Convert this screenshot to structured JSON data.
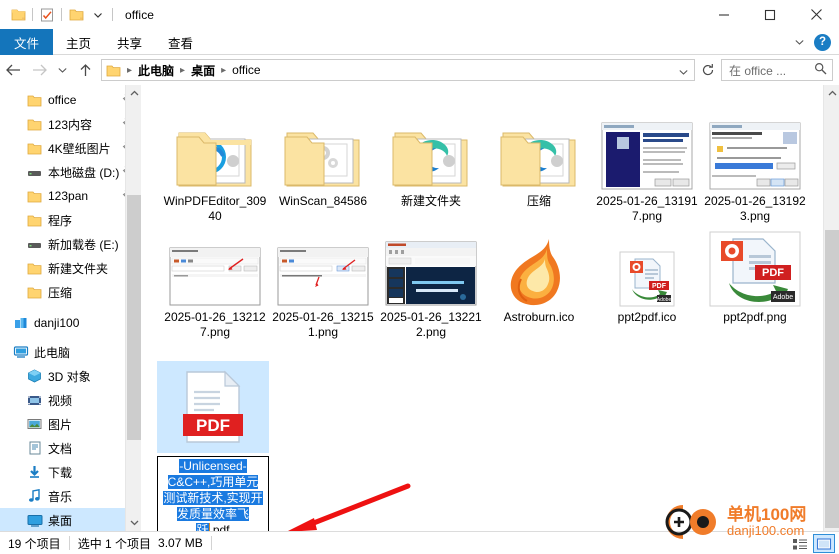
{
  "window": {
    "title": "office",
    "quick_access": [
      {
        "name": "folder-icon",
        "label": "文件夹"
      },
      {
        "name": "properties-icon",
        "label": "属性"
      },
      {
        "name": "new-folder-icon",
        "label": "新建文件夹"
      },
      {
        "name": "chevron-down-icon",
        "label": "自定义快速访问工具栏"
      }
    ],
    "controls": {
      "minimize": "最小化",
      "maximize": "最大化",
      "close": "关闭"
    }
  },
  "ribbon": {
    "tabs": [
      {
        "label": "文件",
        "active": true
      },
      {
        "label": "主页",
        "active": false
      },
      {
        "label": "共享",
        "active": false
      },
      {
        "label": "查看",
        "active": false
      }
    ],
    "collapse_label": "展开功能区",
    "help_label": "?"
  },
  "address": {
    "back": "后退",
    "forward": "前进",
    "recent": "最近浏览的位置",
    "up": "上一级",
    "crumbs": [
      "此电脑",
      "桌面",
      "office"
    ],
    "dropdown": "历史记录",
    "refresh": "刷新",
    "search_placeholder": "在 office ..."
  },
  "sidebar": {
    "items": [
      {
        "label": "office",
        "icon": "folder-icon",
        "pinned": true,
        "indent": 1
      },
      {
        "label": "123内容",
        "icon": "folder-icon",
        "pinned": true,
        "indent": 1
      },
      {
        "label": "4K壁纸图片",
        "icon": "folder-icon",
        "pinned": true,
        "indent": 1
      },
      {
        "label": "本地磁盘 (D:)",
        "icon": "drive-icon",
        "pinned": true,
        "indent": 1
      },
      {
        "label": "123pan",
        "icon": "folder-icon",
        "pinned": true,
        "indent": 1
      },
      {
        "label": "程序",
        "icon": "folder-icon",
        "pinned": false,
        "indent": 1
      },
      {
        "label": "新加载卷 (E:)",
        "icon": "drive-icon",
        "pinned": false,
        "indent": 1
      },
      {
        "label": "新建文件夹",
        "icon": "folder-icon",
        "pinned": false,
        "indent": 1
      },
      {
        "label": "压缩",
        "icon": "folder-icon",
        "pinned": false,
        "indent": 1
      },
      {
        "label": "danji100",
        "icon": "onedrive-icon",
        "pinned": false,
        "indent": 0
      },
      {
        "label": "此电脑",
        "icon": "this-pc-icon",
        "pinned": false,
        "indent": 0
      },
      {
        "label": "3D 对象",
        "icon": "3d-objects-icon",
        "pinned": false,
        "indent": 1
      },
      {
        "label": "视频",
        "icon": "videos-icon",
        "pinned": false,
        "indent": 1
      },
      {
        "label": "图片",
        "icon": "pictures-icon",
        "pinned": false,
        "indent": 1
      },
      {
        "label": "文档",
        "icon": "documents-icon",
        "pinned": false,
        "indent": 1
      },
      {
        "label": "下载",
        "icon": "downloads-icon",
        "pinned": false,
        "indent": 1
      },
      {
        "label": "音乐",
        "icon": "music-icon",
        "pinned": false,
        "indent": 1
      },
      {
        "label": "桌面",
        "icon": "desktop-icon",
        "pinned": false,
        "indent": 1,
        "selected": true
      }
    ]
  },
  "files": {
    "items": [
      {
        "name": "WinPDFEditor_30940",
        "type": "folder",
        "overlay": "ie-icon"
      },
      {
        "name": "WinScan_84586",
        "type": "folder",
        "overlay": "gears-icon"
      },
      {
        "name": "新建文件夹",
        "type": "folder",
        "overlay": "edge-icon"
      },
      {
        "name": "压缩",
        "type": "folder",
        "overlay": "edge-icon"
      },
      {
        "name": "2025-01-26_131917.png",
        "type": "screenshot-wizard-blue"
      },
      {
        "name": "2025-01-26_131923.png",
        "type": "screenshot-wizard-white"
      },
      {
        "name": "2025-01-26_132127.png",
        "type": "screenshot-window"
      },
      {
        "name": "2025-01-26_132151.png",
        "type": "screenshot-window"
      },
      {
        "name": "2025-01-26_132212.png",
        "type": "screenshot-ppt"
      },
      {
        "name": "Astroburn.ico",
        "type": "flame-icon"
      },
      {
        "name": "ppt2pdf.ico",
        "type": "ppt2pdf-icon-small"
      },
      {
        "name": "ppt2pdf.png",
        "type": "ppt2pdf-icon-large"
      }
    ],
    "renaming": {
      "selected_text": "-Unlicensed-C&C++,巧用单元测试新技术,实现开发质量效率飞跃",
      "extension": ".pdf",
      "lines": [
        "-Unlicensed-",
        "C&C++,巧用单元",
        "测试新技术,实现开",
        "发质量效率飞",
        "跃"
      ],
      "type": "pdf-document-icon"
    }
  },
  "status": {
    "item_count": "19 个项目",
    "selection": "选中 1 个项目",
    "size": "3.07 MB",
    "views": [
      {
        "name": "details-view",
        "active": false
      },
      {
        "name": "large-icons-view",
        "active": true
      }
    ]
  },
  "watermark": {
    "line1": "单机100网",
    "line2": "danji100.com"
  },
  "annotation": {
    "arrow_color": "#ee1111",
    "points_to": "rename-textbox"
  }
}
